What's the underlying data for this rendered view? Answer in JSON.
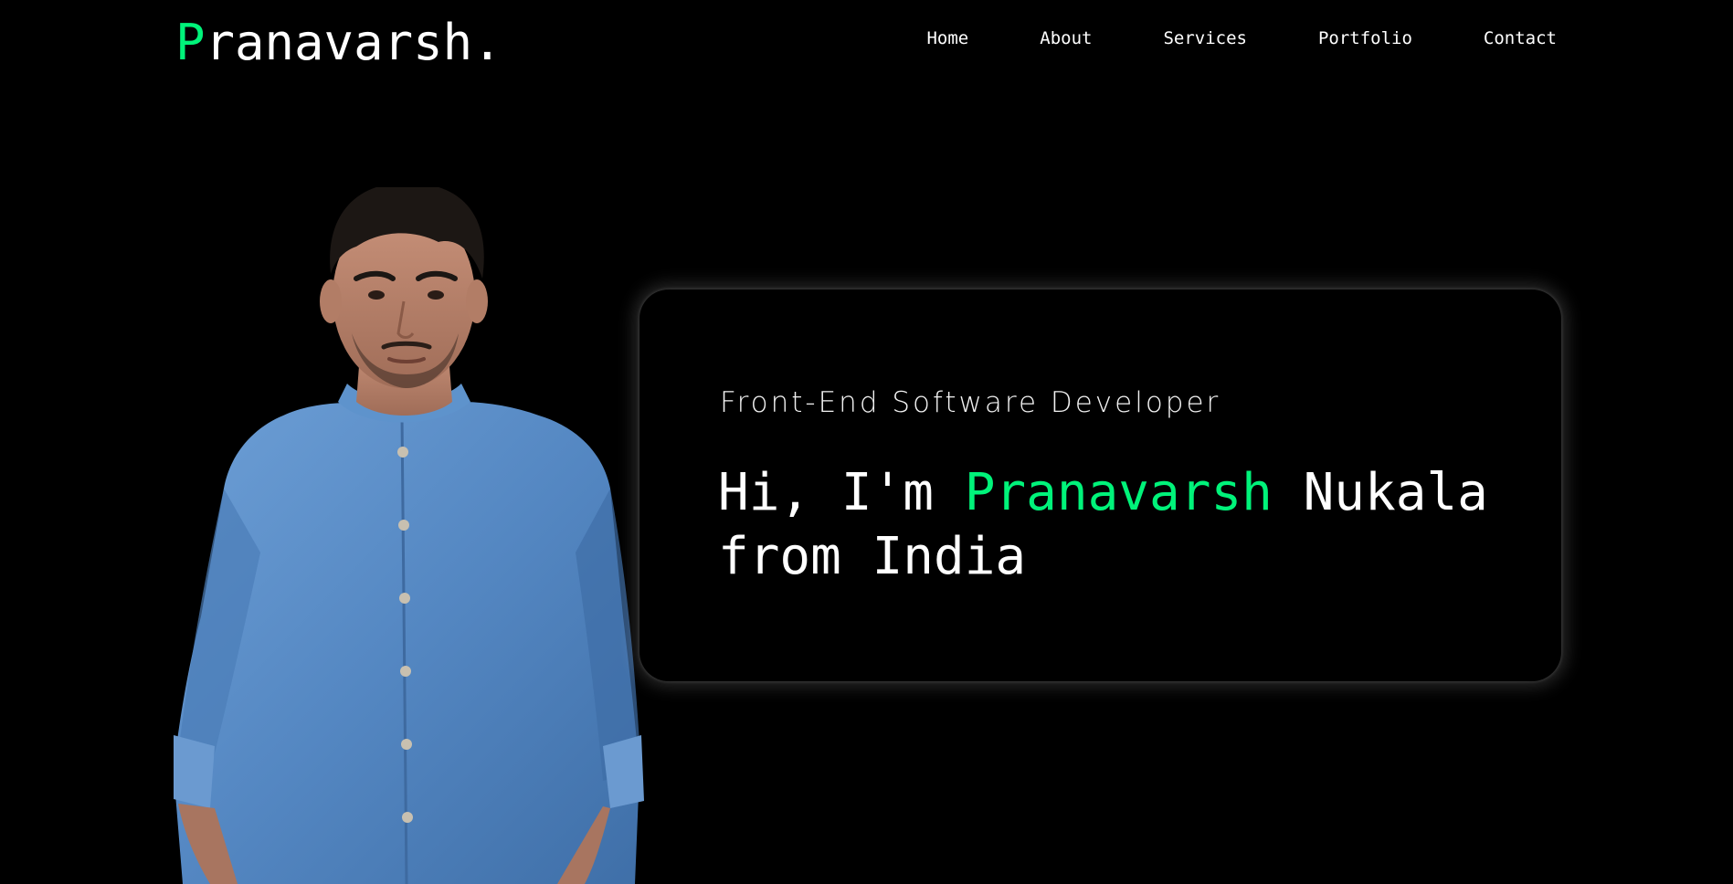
{
  "brand": {
    "logo_first_letter": "P",
    "logo_rest": "ranavarsh.",
    "accent_color": "#00f37a"
  },
  "nav": {
    "items": [
      {
        "label": "Home"
      },
      {
        "label": "About"
      },
      {
        "label": "Services"
      },
      {
        "label": "Portfolio"
      },
      {
        "label": "Contact"
      }
    ]
  },
  "hero": {
    "role": "Front-End Software Developer",
    "greeting_prefix": "Hi, I'm ",
    "name_highlight": "Pranavarsh",
    "greeting_suffix": " Nukala from India"
  },
  "colors": {
    "background": "#000000",
    "text": "#ffffff",
    "shirt": "#5a8fc8"
  }
}
